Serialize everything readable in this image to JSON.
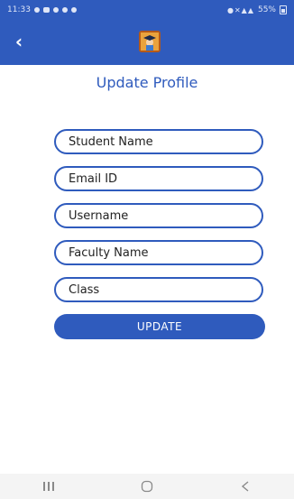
{
  "status_bar": {
    "time": "11:33",
    "battery_label": "55%"
  },
  "app_bar": {
    "back_icon": "arrow-left-icon",
    "logo_icon": "graduate-logo-icon"
  },
  "page": {
    "title": "Update Profile"
  },
  "form": {
    "student_name": {
      "placeholder": "Student Name",
      "value": ""
    },
    "email": {
      "placeholder": "Email ID",
      "value": ""
    },
    "username": {
      "placeholder": "Username",
      "value": ""
    },
    "faculty_name": {
      "placeholder": "Faculty Name",
      "value": ""
    },
    "class": {
      "placeholder": "Class",
      "value": ""
    },
    "submit_label": "UPDATE"
  },
  "nav_bar": {
    "recents_icon": "recents-icon",
    "home_icon": "home-icon",
    "back_icon": "back-chevron-icon"
  },
  "colors": {
    "primary": "#2f5bbd",
    "background": "#ffffff",
    "logo_bg": "#e9a33d"
  }
}
